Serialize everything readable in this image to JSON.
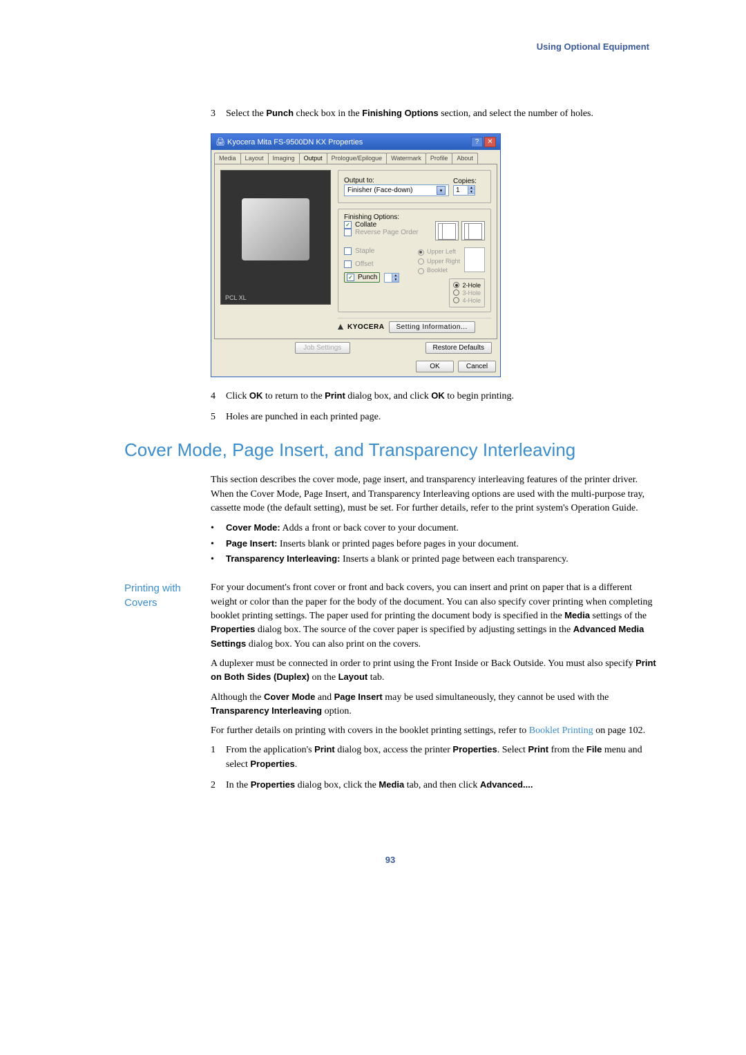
{
  "header": {
    "chapter_title": "Using Optional Equipment"
  },
  "steps_top": {
    "s3": {
      "num": "3",
      "text_a": "Select the ",
      "b1": "Punch",
      "text_b": " check box in the ",
      "b2": "Finishing Options",
      "text_c": " section, and select the number of holes."
    },
    "s4": {
      "num": "4",
      "text_a": "Click ",
      "b1": "OK",
      "text_b": " to return to the ",
      "b2": "Print",
      "text_c": " dialog box, and click ",
      "b3": "OK",
      "text_d": " to begin printing."
    },
    "s5": {
      "num": "5",
      "text": "Holes are punched in each printed page."
    }
  },
  "dialog": {
    "title": "Kyocera Mita FS-9500DN KX Properties",
    "tabs": {
      "media": "Media",
      "layout": "Layout",
      "imaging": "Imaging",
      "output": "Output",
      "prologue": "Prologue/Epilogue",
      "watermark": "Watermark",
      "profile": "Profile",
      "about": "About"
    },
    "pcl": "PCL XL",
    "output_to": "Output to:",
    "output_val": "Finisher (Face-down)",
    "copies": "Copies:",
    "copies_val": "1",
    "finishing": "Finishing Options:",
    "collate": "Collate",
    "reverse": "Reverse Page Order",
    "staple": "Staple",
    "offset": "Offset",
    "punch": "Punch",
    "pos": {
      "ul": "Upper Left",
      "ur": "Upper Right",
      "bk": "Booklet"
    },
    "holes": {
      "h2": "2-Hole",
      "h3": "3-Hole",
      "h4": "4-Hole"
    },
    "logo": "KYOCERA",
    "setting_info": "Setting Information...",
    "job_settings": "Job Settings",
    "restore": "Restore Defaults",
    "ok": "OK",
    "cancel": "Cancel"
  },
  "h1": "Cover Mode, Page Insert, and Transparency Interleaving",
  "intro": "This section describes the cover mode, page insert, and transparency interleaving features of the printer driver. When the Cover Mode, Page Insert, and Transparency Interleaving options are used with the multi-purpose tray, cassette mode (the default setting), must be set. For further details, refer to the print system's Operation Guide.",
  "bullets": {
    "cm": {
      "b": "Cover Mode:",
      "t": " Adds a front or back cover to your document."
    },
    "pi": {
      "b": "Page Insert:",
      "t": " Inserts blank or printed pages before pages in your document."
    },
    "ti": {
      "b": "Transparency Interleaving:",
      "t": " Inserts a blank or printed page between each transparency."
    }
  },
  "side": {
    "printing_with_covers": "Printing with Covers"
  },
  "covers": {
    "p1a": "For your document's front cover or front and back covers, you can insert and print on paper that is a different weight or color than the paper for the body of the document. You can also specify cover printing when completing booklet printing settings. The paper used for printing the document body is specified in the ",
    "p1b1": "Media",
    "p1b": " settings of the ",
    "p1b2": "Properties",
    "p1c": " dialog box. The source of the cover paper is specified by adjusting settings in the ",
    "p1b3": "Advanced Media Settings",
    "p1d": " dialog box. You can also print on the covers.",
    "p2a": "A duplexer must be connected in order to print using the Front Inside or Back Outside. You must also specify ",
    "p2b1": "Print on Both Sides (Duplex)",
    "p2b": " on the ",
    "p2b2": "Layout",
    "p2c": " tab.",
    "p3a": "Although the ",
    "p3b1": "Cover Mode",
    "p3b": " and ",
    "p3b2": "Page Insert",
    "p3c": " may be used simultaneously, they cannot be used with the ",
    "p3b3": "Transparency Interleaving",
    "p3d": " option.",
    "p4a": "For further details on printing with covers in the booklet printing settings, refer to ",
    "p4link": "Booklet Printing",
    "p4b": " on page 102.",
    "s1": {
      "num": "1",
      "a": "From the application's ",
      "b1": "Print",
      "b": " dialog box, access the printer ",
      "b2": "Properties",
      "c": ". Select ",
      "b3": "Print",
      "d": " from the ",
      "b4": "File",
      "e": " menu and select ",
      "b5": "Properties",
      "f": "."
    },
    "s2": {
      "num": "2",
      "a": "In the ",
      "b1": "Properties",
      "b": " dialog box, click the ",
      "b2": "Media",
      "c": " tab, and then click ",
      "b3": "Advanced....",
      "d": ""
    }
  },
  "page_num": "93"
}
